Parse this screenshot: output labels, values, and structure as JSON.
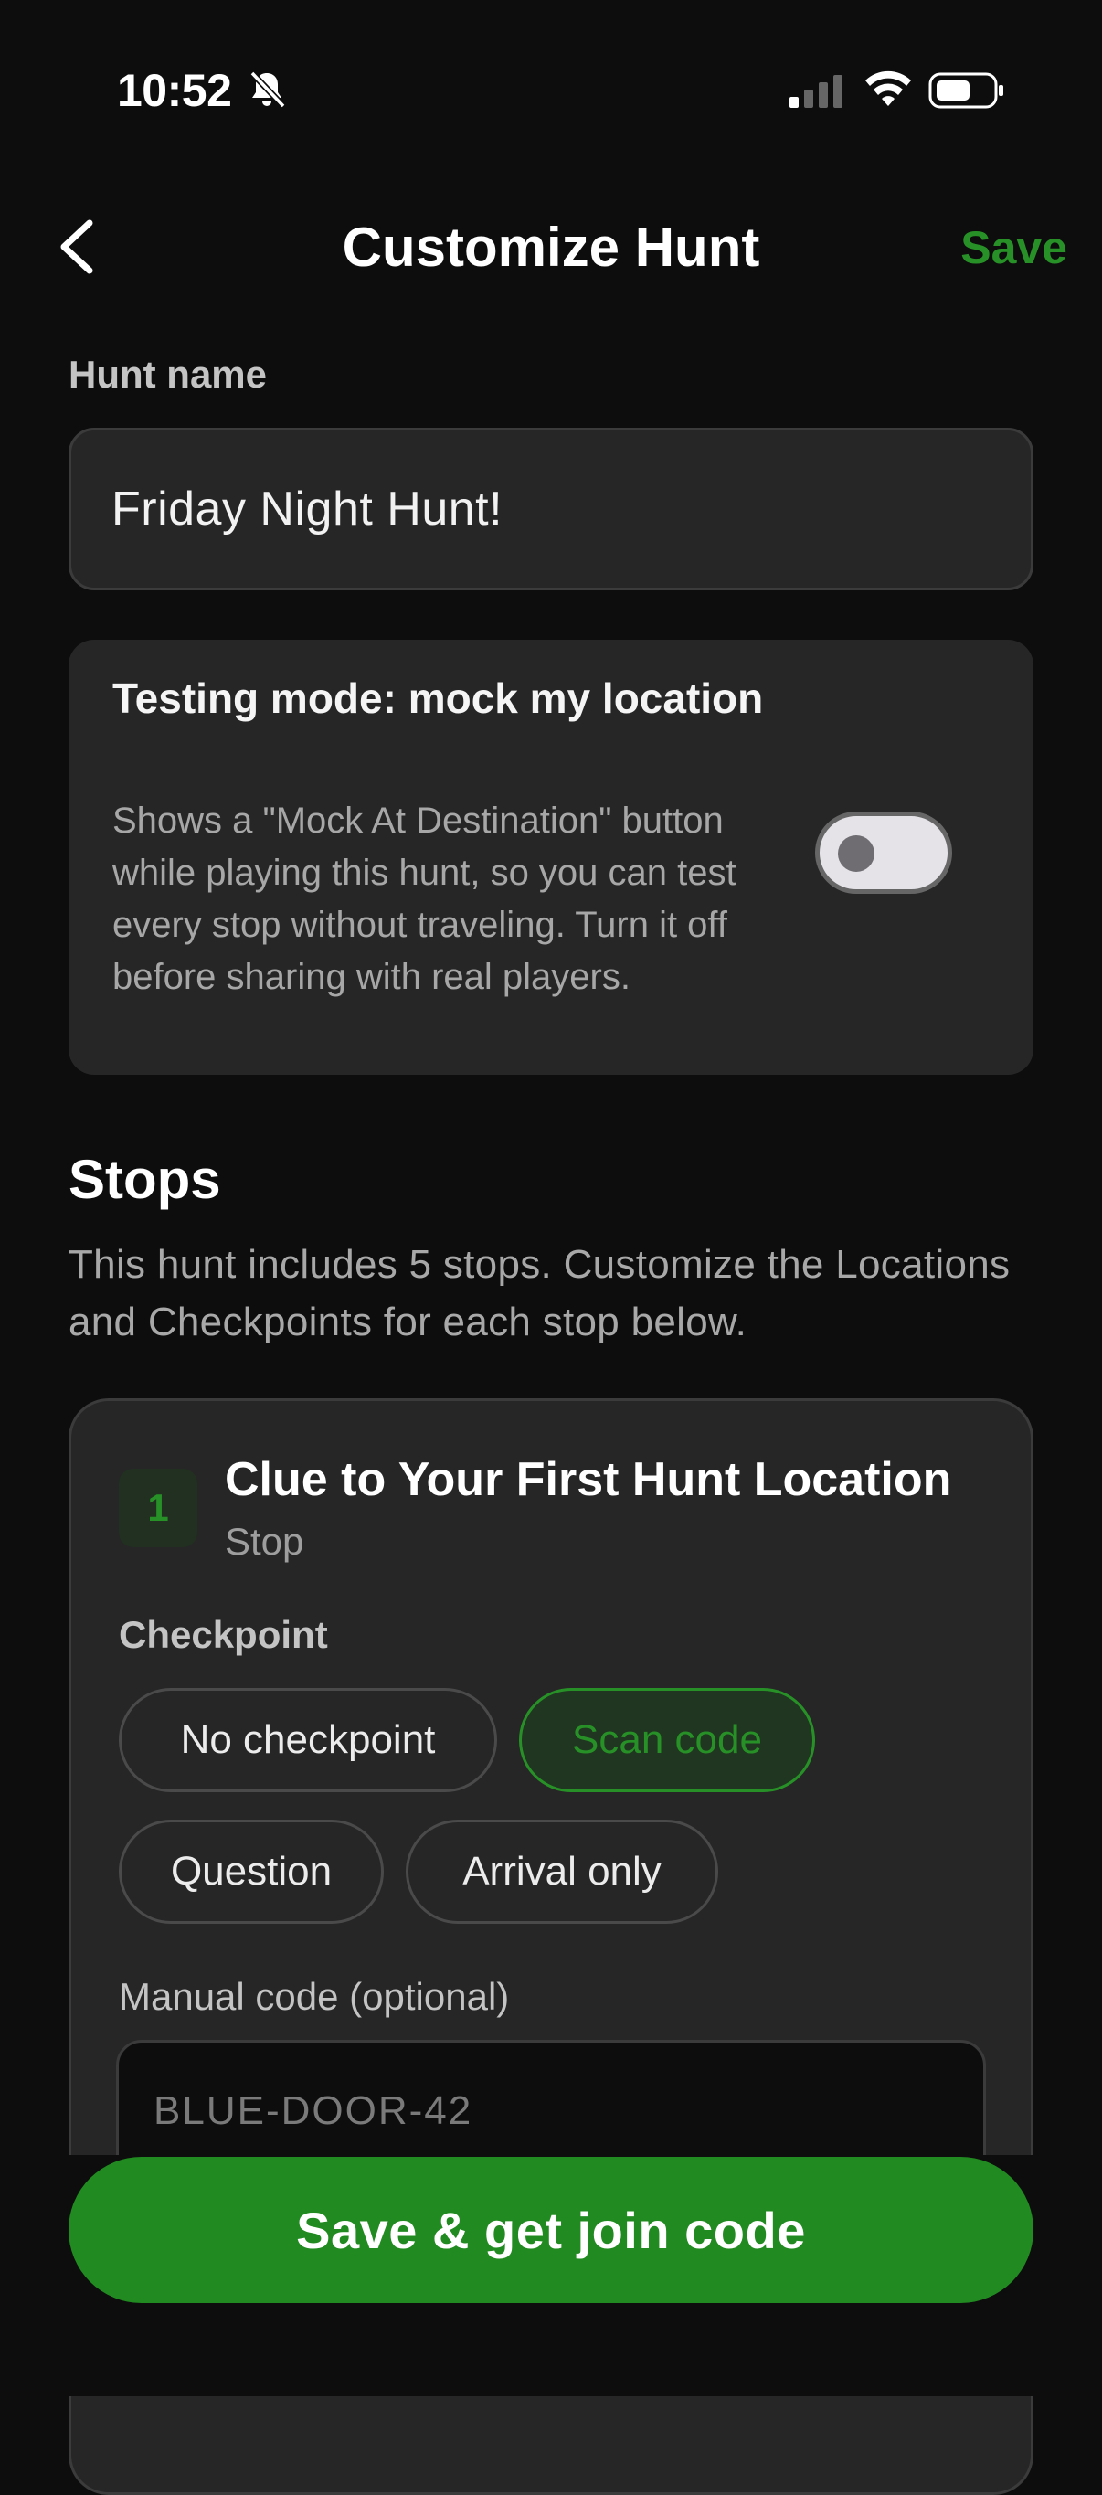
{
  "status_bar": {
    "time": "10:52"
  },
  "header": {
    "title": "Customize Hunt",
    "save_label": "Save"
  },
  "hunt_name": {
    "label": "Hunt name",
    "value": "Friday Night Hunt!"
  },
  "testing_mode": {
    "title": "Testing mode: mock my location",
    "description": "Shows a \"Mock At Destination\" button while playing this hunt, so you can test every stop without traveling. Turn it off before sharing with real players.",
    "enabled": false
  },
  "stops": {
    "heading": "Stops",
    "description": "This hunt includes 5 stops. Customize the Locations and Checkpoints for each stop below.",
    "items": [
      {
        "number": "1",
        "title": "Clue to Your First Hunt Location",
        "subtitle": "Stop",
        "checkpoint_label": "Checkpoint",
        "checkpoint_options": [
          "No checkpoint",
          "Scan code",
          "Question",
          "Arrival only"
        ],
        "selected_checkpoint": "Scan code",
        "manual_code_label": "Manual code (optional)",
        "manual_code_placeholder": "BLUE-DOOR-42"
      }
    ]
  },
  "footer": {
    "primary_label": "Save & get join code"
  },
  "colors": {
    "accent": "#279127",
    "background": "#0d0d0d",
    "card": "#262626",
    "primary_button": "#218b21"
  }
}
